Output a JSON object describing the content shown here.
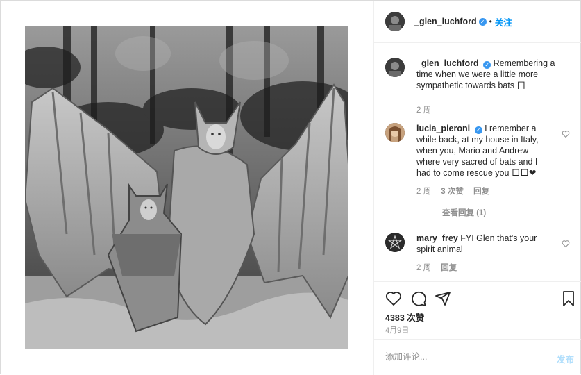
{
  "post": {
    "photo_alt": "photo",
    "author": {
      "username": "_glen_luchford",
      "verified_mark": "✓",
      "separator": "•",
      "follow_label": "关注"
    },
    "caption": {
      "username": "_glen_luchford",
      "text": "Remembering a time when we were a little more sympathetic towards bats ⼝",
      "time": "2 周"
    },
    "comments": [
      {
        "username": "lucia_pieroni",
        "verified": true,
        "text": "I remember a while back, at my house in Italy, when you, Mario and Andrew where very sacred of bats and I had to come rescue you ⼝⼝❤",
        "time": "2 周",
        "likes": "3 次赞",
        "reply_label": "回复",
        "view_replies_label": "查看回复 (1)",
        "heart_icon": "heart-outline-icon"
      },
      {
        "username": "mary_frey",
        "verified": false,
        "text": "FYI Glen that's your spirit animal",
        "time": "2 周",
        "reply_label": "回复",
        "heart_icon": "heart-outline-icon"
      }
    ],
    "actions": {
      "like_icon": "heart-icon",
      "comment_icon": "comment-icon",
      "share_icon": "share-icon",
      "save_icon": "bookmark-icon"
    },
    "likes_count": "4383 次赞",
    "date": "4月9日",
    "composer": {
      "placeholder": "添加评论...",
      "post_label": "发布"
    },
    "colors": {
      "link_blue": "#0095f6",
      "verified_blue": "#3897f0",
      "muted_gray": "#8e8e8e",
      "post_disabled": "#b2dffc"
    }
  }
}
